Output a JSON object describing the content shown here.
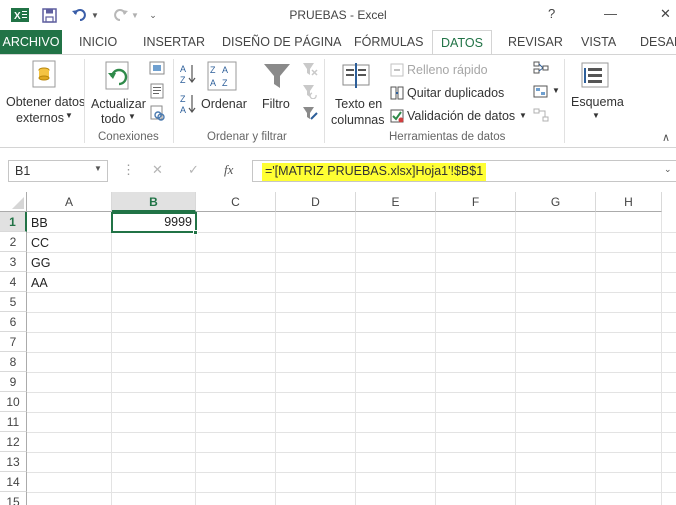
{
  "window": {
    "title": "PRUEBAS - Excel",
    "help_label": "?",
    "minimize_label": "—",
    "close_label": "✕"
  },
  "tabs": [
    "ARCHIVO",
    "INICIO",
    "INSERTAR",
    "DISEÑO DE PÁGINA",
    "FÓRMULAS",
    "DATOS",
    "REVISAR",
    "VISTA",
    "DESAF"
  ],
  "ribbon": {
    "external_data": {
      "line1": "Obtener datos",
      "line2": "externos"
    },
    "refresh": {
      "line1": "Actualizar",
      "line2": "todo"
    },
    "connections_group": "Conexiones",
    "sort_label": "Ordenar",
    "filter_label": "Filtro",
    "sort_filter_group": "Ordenar y filtrar",
    "text_to_columns": {
      "line1": "Texto en",
      "line2": "columnas"
    },
    "flash_fill": "Relleno rápido",
    "remove_duplicates": "Quitar duplicados",
    "data_validation": "Validación de datos",
    "data_tools_group": "Herramientas de datos",
    "outline_label": "Esquema"
  },
  "formula_bar": {
    "name_box": "B1",
    "cancel": "✕",
    "enter": "✓",
    "fx": "fx",
    "formula": "='[MATRIZ PRUEBAS.xlsx]Hoja1'!$B$1"
  },
  "sheet": {
    "columns": [
      "A",
      "B",
      "C",
      "D",
      "E",
      "F",
      "G",
      "H"
    ],
    "rows": [
      "1",
      "2",
      "3",
      "4",
      "5",
      "6",
      "7",
      "8",
      "9",
      "10",
      "11",
      "12",
      "13",
      "14",
      "15"
    ],
    "col_a": [
      "BB",
      "CC",
      "GG",
      "AA"
    ],
    "b1_value": "9999"
  },
  "colors": {
    "accent": "#217346",
    "highlight": "#ffff33"
  }
}
